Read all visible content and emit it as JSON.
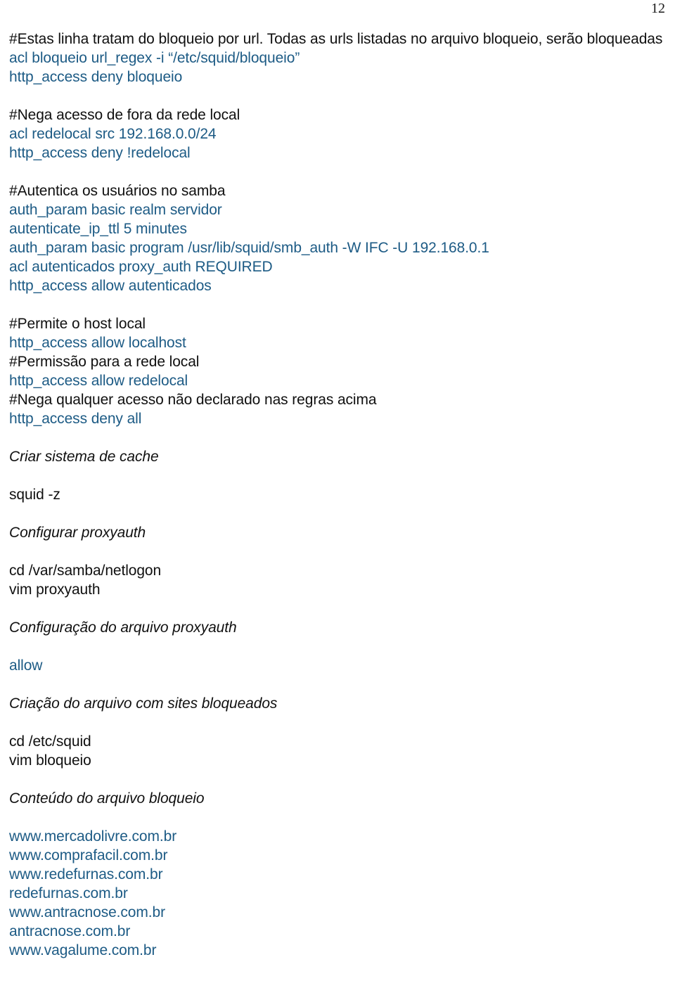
{
  "page": {
    "number": "12"
  },
  "document": {
    "blocks": [
      {
        "type": "comment",
        "text": "#Estas linha tratam do bloqueio por url. Todas as urls listadas no arquivo bloqueio, serão bloqueadas"
      },
      {
        "type": "code",
        "text": "acl bloqueio url_regex -i “/etc/squid/bloqueio”"
      },
      {
        "type": "code",
        "text": "http_access deny bloqueio"
      },
      {
        "type": "spacer",
        "text": ""
      },
      {
        "type": "comment",
        "text": "#Nega acesso de fora da rede local"
      },
      {
        "type": "code",
        "text": "acl redelocal src 192.168.0.0/24"
      },
      {
        "type": "code",
        "text": "http_access deny !redelocal"
      },
      {
        "type": "spacer",
        "text": ""
      },
      {
        "type": "comment",
        "text": "#Autentica os usuários no samba"
      },
      {
        "type": "code",
        "text": "auth_param basic realm servidor"
      },
      {
        "type": "code",
        "text": "autenticate_ip_ttl 5 minutes"
      },
      {
        "type": "code",
        "text": "auth_param basic program /usr/lib/squid/smb_auth -W IFC -U 192.168.0.1"
      },
      {
        "type": "code",
        "text": "acl autenticados proxy_auth REQUIRED"
      },
      {
        "type": "code",
        "text": "http_access allow autenticados"
      },
      {
        "type": "spacer",
        "text": ""
      },
      {
        "type": "comment",
        "text": "#Permite o host local"
      },
      {
        "type": "code",
        "text": "http_access allow localhost"
      },
      {
        "type": "comment",
        "text": "#Permissão para a rede local"
      },
      {
        "type": "code",
        "text": "http_access allow redelocal"
      },
      {
        "type": "comment",
        "text": "#Nega qualquer acesso não declarado nas regras acima"
      },
      {
        "type": "code",
        "text": "http_access deny all"
      },
      {
        "type": "spacer",
        "text": ""
      },
      {
        "type": "heading",
        "text": "Criar sistema de cache"
      },
      {
        "type": "spacer",
        "text": ""
      },
      {
        "type": "plain",
        "text": "squid -z"
      },
      {
        "type": "spacer",
        "text": ""
      },
      {
        "type": "heading",
        "text": "Configurar proxyauth"
      },
      {
        "type": "spacer",
        "text": ""
      },
      {
        "type": "plain",
        "text": "cd /var/samba/netlogon"
      },
      {
        "type": "plain",
        "text": "vim proxyauth"
      },
      {
        "type": "spacer",
        "text": ""
      },
      {
        "type": "heading",
        "text": "Configuração do arquivo proxyauth"
      },
      {
        "type": "spacer",
        "text": ""
      },
      {
        "type": "code",
        "text": "allow"
      },
      {
        "type": "spacer",
        "text": ""
      },
      {
        "type": "heading",
        "text": "Criação do arquivo com sites bloqueados"
      },
      {
        "type": "spacer",
        "text": ""
      },
      {
        "type": "plain",
        "text": "cd /etc/squid"
      },
      {
        "type": "plain",
        "text": "vim bloqueio"
      },
      {
        "type": "spacer",
        "text": ""
      },
      {
        "type": "heading",
        "text": "Conteúdo do arquivo bloqueio"
      },
      {
        "type": "spacer",
        "text": ""
      },
      {
        "type": "code",
        "text": "www.mercadolivre.com.br"
      },
      {
        "type": "code",
        "text": "www.comprafacil.com.br"
      },
      {
        "type": "code",
        "text": "www.redefurnas.com.br"
      },
      {
        "type": "code",
        "text": "redefurnas.com.br"
      },
      {
        "type": "code",
        "text": "www.antracnose.com.br"
      },
      {
        "type": "code",
        "text": "antracnose.com.br"
      },
      {
        "type": "code",
        "text": "www.vagalume.com.br"
      }
    ]
  },
  "colors": {
    "code_blue": "#1d5b85",
    "text_black": "#101010",
    "page_background": "#ffffff"
  }
}
